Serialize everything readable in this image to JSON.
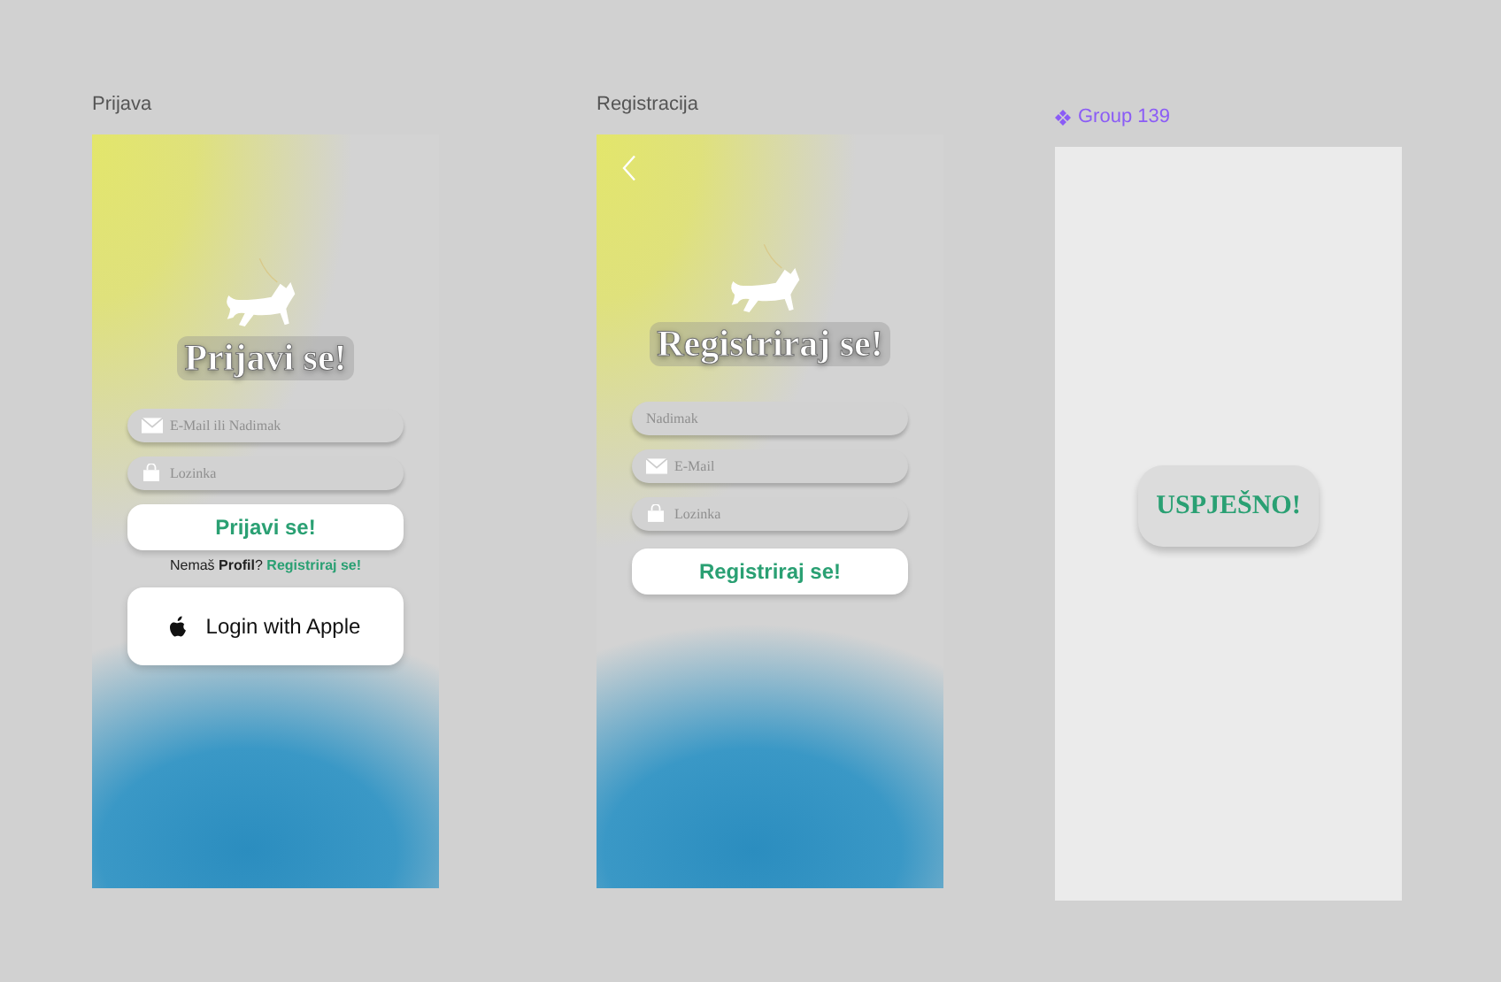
{
  "frames": [
    {
      "kind": "login",
      "label": "Prijava",
      "component": false,
      "back": false,
      "heading": "Prijavi se!",
      "fields": [
        {
          "kind": "mail",
          "placeholder": "E-Mail ili Nadimak"
        },
        {
          "kind": "lock",
          "placeholder": "Lozinka"
        }
      ],
      "submit": "Prijavi se!",
      "prompt": {
        "text": "Nemaš **Profil**?",
        "link": "Registriraj se!"
      },
      "apple_button": "Login with Apple"
    },
    {
      "kind": "register",
      "label": "Registracija",
      "component": false,
      "back": true,
      "heading": "Registriraj se!",
      "fields": [
        {
          "kind": "plain",
          "placeholder": "Nadimak"
        },
        {
          "kind": "mail",
          "placeholder": "E-Mail"
        },
        {
          "kind": "lock",
          "placeholder": "Lozinka"
        }
      ],
      "submit": "Registriraj se!"
    },
    {
      "kind": "success",
      "label": "Group 139",
      "component": true,
      "message": "USPJEŠNO!"
    }
  ]
}
